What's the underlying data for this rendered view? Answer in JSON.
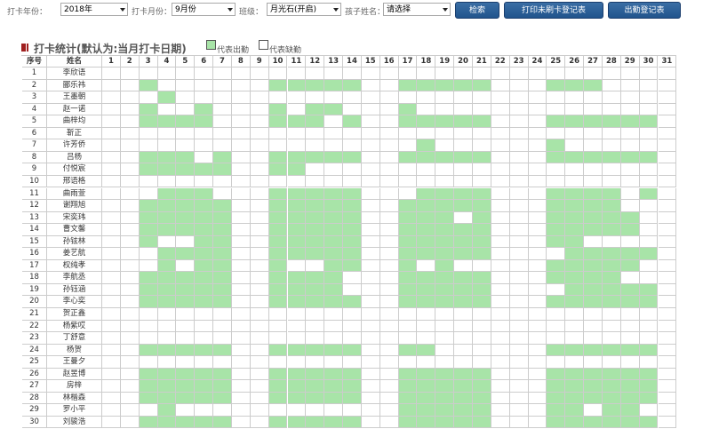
{
  "filters": {
    "year_label": "打卡年份：",
    "year_value": "2018年",
    "month_label": "打卡月份：",
    "month_value": "9月份",
    "class_label": "班级：",
    "class_value": "月光石(开启)",
    "child_label": "孩子姓名：",
    "child_value": "请选择",
    "search_button": "检索",
    "print_button": "打印未刷卡登记表",
    "attendance_button": "出勤登记表"
  },
  "section": {
    "title": "打卡统计(默认为:当月打卡日期)",
    "legend_present": "代表出勤",
    "legend_absent": "代表缺勤"
  },
  "colors": {
    "present": "#a8e4a8",
    "absent": "#ffffff",
    "button": "#21548c"
  },
  "table": {
    "headers": {
      "seq": "序号",
      "name": "姓名"
    },
    "days": [
      "1",
      "2",
      "3",
      "4",
      "5",
      "6",
      "7",
      "8",
      "9",
      "10",
      "11",
      "12",
      "13",
      "14",
      "15",
      "16",
      "17",
      "18",
      "19",
      "20",
      "21",
      "22",
      "23",
      "24",
      "25",
      "26",
      "27",
      "28",
      "29",
      "30",
      "31"
    ],
    "rows": [
      {
        "seq": "1",
        "name": "李欣语",
        "present": []
      },
      {
        "seq": "2",
        "name": "郦乐祎",
        "present": [
          3,
          10,
          11,
          12,
          13,
          14,
          17,
          18,
          19,
          20,
          21,
          25,
          26,
          27
        ]
      },
      {
        "seq": "3",
        "name": "王墨朝",
        "present": [
          4
        ]
      },
      {
        "seq": "4",
        "name": "赵一诺",
        "present": [
          3,
          6,
          10,
          12,
          13,
          17
        ]
      },
      {
        "seq": "5",
        "name": "曲梓均",
        "present": [
          3,
          4,
          5,
          6,
          10,
          11,
          12,
          14,
          17,
          18,
          19,
          20,
          21,
          25,
          26,
          27,
          28,
          29,
          30
        ]
      },
      {
        "seq": "6",
        "name": "靳正",
        "present": []
      },
      {
        "seq": "7",
        "name": "许芳侨",
        "present": [
          18,
          25
        ]
      },
      {
        "seq": "8",
        "name": "吕杨",
        "present": [
          3,
          4,
          5,
          7,
          10,
          11,
          12,
          13,
          14,
          17,
          18,
          19,
          20,
          21,
          25,
          26,
          27,
          28,
          29,
          30
        ]
      },
      {
        "seq": "9",
        "name": "付悦宸",
        "present": [
          3,
          4,
          5,
          6,
          7,
          10,
          11
        ]
      },
      {
        "seq": "10",
        "name": "邢语格",
        "present": []
      },
      {
        "seq": "11",
        "name": "曲雨萱",
        "present": [
          4,
          5,
          6,
          10,
          11,
          12,
          13,
          14,
          18,
          19,
          20,
          21,
          25,
          26,
          27,
          28,
          30
        ]
      },
      {
        "seq": "12",
        "name": "谢翔旭",
        "present": [
          3,
          4,
          5,
          6,
          7,
          10,
          11,
          12,
          13,
          14,
          17,
          18,
          19,
          20,
          21,
          25,
          26,
          27,
          28
        ]
      },
      {
        "seq": "13",
        "name": "宋奕玮",
        "present": [
          3,
          4,
          5,
          6,
          7,
          10,
          11,
          12,
          13,
          14,
          17,
          18,
          19,
          21,
          25,
          26,
          27,
          28,
          29
        ]
      },
      {
        "seq": "14",
        "name": "曹文馨",
        "present": [
          3,
          4,
          5,
          6,
          7,
          10,
          11,
          12,
          13,
          14,
          17,
          18,
          19,
          20,
          21,
          25,
          26,
          27,
          28,
          29
        ]
      },
      {
        "seq": "15",
        "name": "孙铉林",
        "present": [
          3,
          6,
          7,
          10,
          11,
          12,
          13,
          14,
          17,
          18,
          19,
          20,
          21,
          25,
          26
        ]
      },
      {
        "seq": "16",
        "name": "姜艺航",
        "present": [
          4,
          5,
          6,
          7,
          10,
          11,
          12,
          13,
          14,
          17,
          18,
          19,
          20,
          21,
          26,
          27,
          28,
          29,
          30
        ]
      },
      {
        "seq": "17",
        "name": "权纯孝",
        "present": [
          4,
          6,
          7,
          10,
          13,
          14,
          17,
          19,
          25,
          26,
          27,
          28,
          29
        ]
      },
      {
        "seq": "18",
        "name": "李航丞",
        "present": [
          3,
          4,
          5,
          6,
          7,
          10,
          11,
          12,
          13,
          17,
          18,
          19,
          20,
          21,
          25,
          26,
          27,
          28
        ]
      },
      {
        "seq": "19",
        "name": "孙钰涵",
        "present": [
          3,
          4,
          5,
          6,
          7,
          10,
          11,
          12,
          13,
          17,
          18,
          19,
          20,
          21,
          26,
          27,
          28,
          29,
          30
        ]
      },
      {
        "seq": "20",
        "name": "李心奕",
        "present": [
          3,
          4,
          5,
          6,
          7,
          10,
          11,
          12,
          13,
          14,
          17,
          18,
          19,
          20,
          21,
          25,
          26,
          27,
          28,
          29,
          30
        ]
      },
      {
        "seq": "21",
        "name": "贺正鑫",
        "present": []
      },
      {
        "seq": "22",
        "name": "杨紫哎",
        "present": []
      },
      {
        "seq": "23",
        "name": "丁舒意",
        "present": []
      },
      {
        "seq": "24",
        "name": "杨贺",
        "present": [
          3,
          4,
          5,
          6,
          7,
          10,
          11,
          12,
          13,
          14,
          17,
          18,
          25,
          26,
          27,
          28,
          29,
          30
        ]
      },
      {
        "seq": "25",
        "name": "王曼夕",
        "present": []
      },
      {
        "seq": "26",
        "name": "赵昱博",
        "present": [
          3,
          4,
          5,
          6,
          7,
          10,
          11,
          12,
          13,
          14,
          17,
          18,
          19,
          20,
          21,
          25,
          26,
          27,
          28,
          29,
          30
        ]
      },
      {
        "seq": "27",
        "name": "房梓",
        "present": [
          3,
          4,
          5,
          6,
          7,
          10,
          11,
          12,
          13,
          14,
          17,
          18,
          19,
          20,
          21,
          25,
          26,
          27,
          28,
          29,
          30
        ]
      },
      {
        "seq": "28",
        "name": "林楷森",
        "present": [
          3,
          4,
          5,
          6,
          7,
          10,
          11,
          12,
          13,
          14,
          17,
          18,
          19,
          20,
          21,
          25,
          26,
          27,
          28,
          29,
          30
        ]
      },
      {
        "seq": "29",
        "name": "罗小平",
        "present": [
          4,
          17,
          18,
          19,
          20,
          21,
          25,
          26,
          28,
          29
        ]
      },
      {
        "seq": "30",
        "name": "刘骏浩",
        "present": [
          3,
          4,
          5,
          6,
          7,
          10,
          11,
          12,
          13,
          14,
          17,
          18,
          19,
          20,
          21,
          25,
          26,
          27,
          28,
          29,
          30
        ]
      }
    ]
  }
}
